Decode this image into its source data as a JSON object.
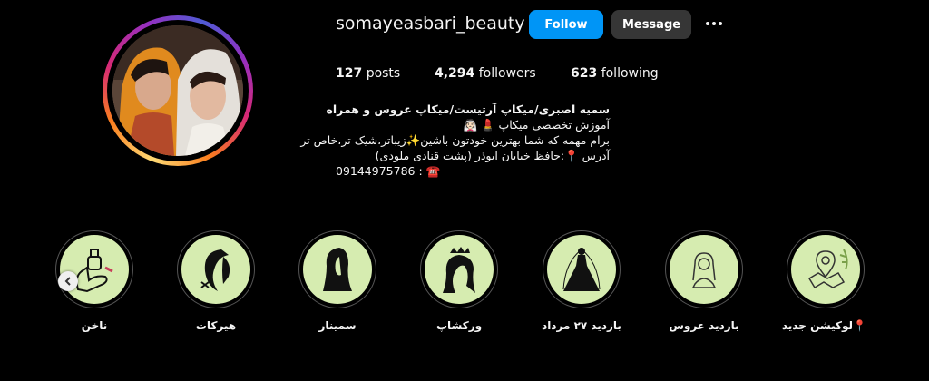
{
  "profile": {
    "username": "somayeasbari_beauty",
    "follow_label": "Follow",
    "message_label": "Message",
    "posts_count": "127",
    "posts_label": "posts",
    "followers_count": "4,294",
    "followers_label": "followers",
    "following_count": "623",
    "following_label": "following"
  },
  "bio": {
    "name": "سمیه اصبری/میکاپ آرتیست/میکاپ عروس و همراه",
    "line1": "آموزش تخصصی میکاپ 💄 👰🏻",
    "line2": "برام مهمه که شما بهترین خودتون باشین✨زیباتر،شیک تر،خاص تر",
    "line3": "آدرس 📍:حافظ خیابان ابوذر (پشت قنادی ملودی)",
    "line4": "09144975786 : ☎️"
  },
  "highlights": [
    {
      "label": "ناخن",
      "icon": "nail-hand-icon"
    },
    {
      "label": "هیرکات",
      "icon": "haircut-woman-icon"
    },
    {
      "label": "سمینار",
      "icon": "woman-silhouette-icon"
    },
    {
      "label": "ورکشاپ",
      "icon": "crowned-woman-icon"
    },
    {
      "label": "بازدید ۲۷ مرداد",
      "icon": "bride-dress-icon"
    },
    {
      "label": "بازدید عروس",
      "icon": "bride-outline-icon"
    },
    {
      "label": "📍لوکیشن جدید",
      "icon": "location-map-icon"
    }
  ],
  "colors": {
    "follow_button": "#0095f6",
    "message_button": "#363636",
    "highlight_disc": "#d6ecb0"
  }
}
